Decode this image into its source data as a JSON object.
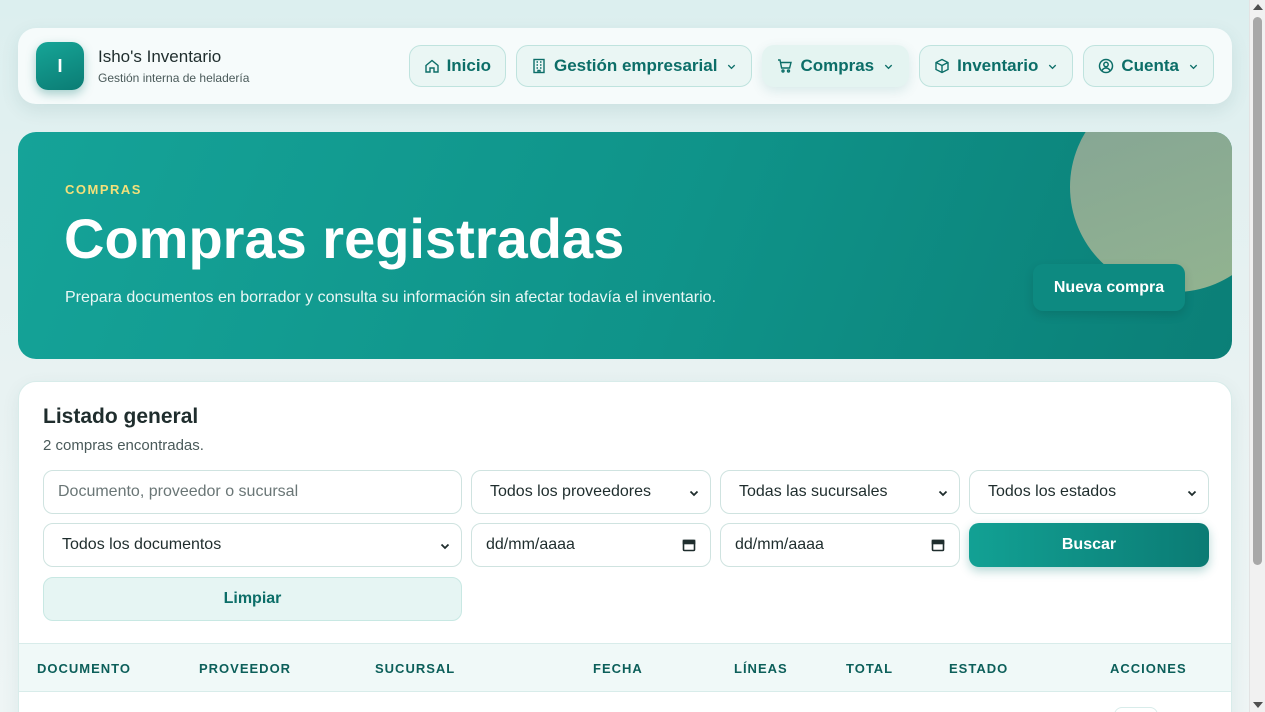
{
  "brand": {
    "logo_letter": "I",
    "title": "Isho's Inventario",
    "subtitle": "Gestión interna de heladería"
  },
  "nav": {
    "inicio": {
      "label": "Inicio",
      "icon": "home-icon"
    },
    "gestion": {
      "label": "Gestión empresarial",
      "icon": "building-icon"
    },
    "compras": {
      "label": "Compras",
      "icon": "cart-icon"
    },
    "inventario": {
      "label": "Inventario",
      "icon": "box-icon"
    },
    "cuenta": {
      "label": "Cuenta",
      "icon": "user-circle-icon"
    }
  },
  "hero": {
    "eyebrow": "COMPRAS",
    "title": "Compras registradas",
    "description": "Prepara documentos en borrador y consulta su información sin afectar todavía el inventario.",
    "button_label": "Nueva compra"
  },
  "listing": {
    "title": "Listado general",
    "count_text": "2 compras encontradas.",
    "filters": {
      "search_placeholder": "Documento, proveedor o sucursal",
      "provider_selected": "Todos los proveedores",
      "branch_selected": "Todas las sucursales",
      "status_selected": "Todos los estados",
      "document_selected": "Todos los documentos",
      "date_from_placeholder": "dd/mm/aaaa",
      "date_to_placeholder": "dd/mm/aaaa"
    },
    "search_button": "Buscar",
    "clear_button": "Limpiar",
    "columns": [
      "DOCUMENTO",
      "PROVEEDOR",
      "SUCURSAL",
      "FECHA",
      "LÍNEAS",
      "TOTAL",
      "ESTADO",
      "ACCIONES"
    ]
  },
  "colors": {
    "accent": "#0f9389",
    "accent_dark": "#0b7b74",
    "eyebrow": "#f3e07a",
    "nav_text": "#0c6e68"
  }
}
